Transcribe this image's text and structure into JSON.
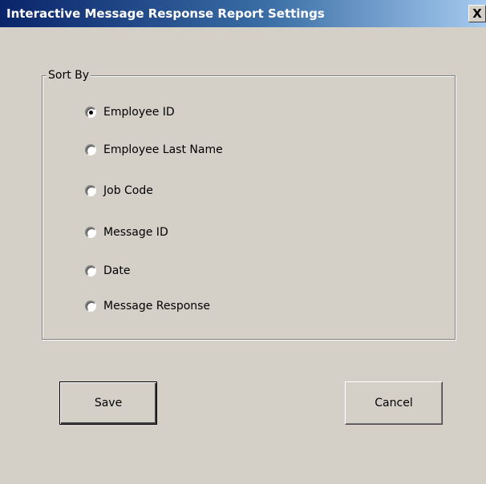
{
  "window": {
    "title": "Interactive Message Response Report Settings",
    "close_glyph": "X"
  },
  "sort_group": {
    "legend": "Sort By",
    "selected": "Employee ID",
    "options": [
      {
        "label": "Employee ID",
        "checked": true
      },
      {
        "label": "Employee Last Name",
        "checked": false
      },
      {
        "label": "Job Code",
        "checked": false
      },
      {
        "label": "Message ID",
        "checked": false
      },
      {
        "label": "Date",
        "checked": false
      },
      {
        "label": "Message Response",
        "checked": false
      }
    ]
  },
  "buttons": {
    "save_label": "Save",
    "cancel_label": "Cancel"
  },
  "colors": {
    "dialog_face": "#d4d0c8",
    "titlebar_start": "#0a246a",
    "titlebar_end": "#a6caf0",
    "title_text": "#ffffff"
  },
  "icons": {
    "close": "close-icon"
  }
}
